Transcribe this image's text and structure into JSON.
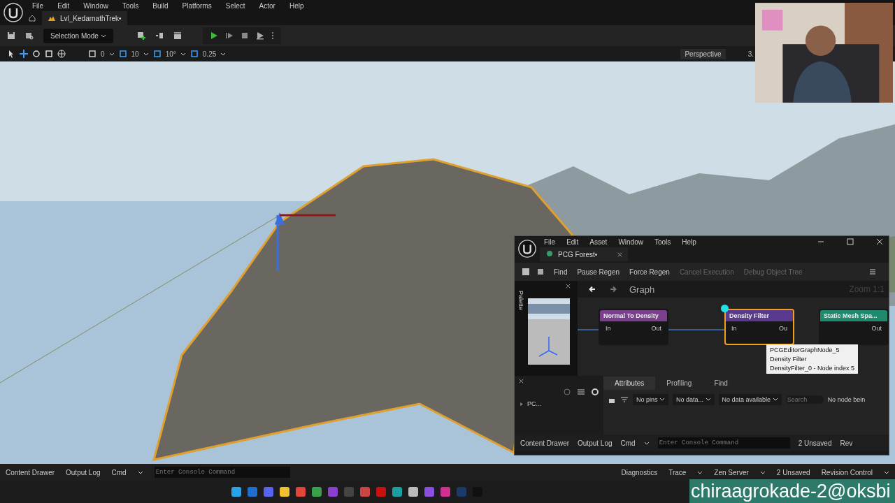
{
  "menu": [
    "File",
    "Edit",
    "Window",
    "Tools",
    "Build",
    "Platforms",
    "Select",
    "Actor",
    "Help"
  ],
  "level_tab": {
    "label": "Lvl_KedarnathTrek•"
  },
  "toolbar": {
    "mode": "Selection Mode"
  },
  "viewport_toolbar": {
    "snaps": [
      "0",
      "10",
      "10°",
      "0.25"
    ],
    "view": "Perspective",
    "cut": "3."
  },
  "pcg_window": {
    "menu": [
      "File",
      "Edit",
      "Asset",
      "Window",
      "Tools",
      "Help"
    ],
    "tab": "PCG Forest•",
    "actions": [
      {
        "label": "Find",
        "disabled": false
      },
      {
        "label": "Pause Regen",
        "disabled": false
      },
      {
        "label": "Force Regen",
        "disabled": false
      },
      {
        "label": "Cancel Execution",
        "disabled": true
      },
      {
        "label": "Debug Object Tree",
        "disabled": true
      }
    ],
    "palette": "Palette",
    "breadcrumb": "Graph",
    "zoom": "Zoom 1:1",
    "nodes": [
      {
        "title": "Normal To Density",
        "color": "#7a3f8f",
        "selected": false,
        "pin_in": "In",
        "pin_out": "Out"
      },
      {
        "title": "Density Filter",
        "color": "#5a3a8f",
        "selected": true,
        "pin_in": "In",
        "pin_out": "Ou"
      },
      {
        "title": "Static Mesh Spa...",
        "color": "#1f8a6e",
        "selected": false,
        "pin_out": "Out"
      }
    ],
    "tooltip": [
      "PCGEditorGraphNode_5",
      "Density Filter",
      "DensityFilter_0 - Node index 5"
    ],
    "tree_item": "PC...",
    "bottom_tabs": [
      {
        "label": "Attributes",
        "selected": true
      },
      {
        "label": "Profiling",
        "selected": false
      },
      {
        "label": "Find",
        "selected": false
      }
    ],
    "filters": [
      "No pins",
      "No data...",
      "No data available"
    ],
    "search_placeholder": "Search",
    "status": "No node bein",
    "status_bar": {
      "content_drawer": "Content Drawer",
      "output_log": "Output Log",
      "cmd": "Cmd",
      "console_placeholder": "Enter Console Command",
      "unsaved": "2 Unsaved",
      "cut": "Rev"
    }
  },
  "status_bar": {
    "content_drawer": "Content Drawer",
    "output_log": "Output Log",
    "cmd": "Cmd",
    "console_placeholder": "Enter Console Command",
    "diagnostics": "Diagnostics",
    "trace": "Trace",
    "zen": "Zen Server",
    "unsaved": "2 Unsaved",
    "revision": "Revision Control"
  },
  "overlay_text": "chiraagrokade-2@oksbi"
}
